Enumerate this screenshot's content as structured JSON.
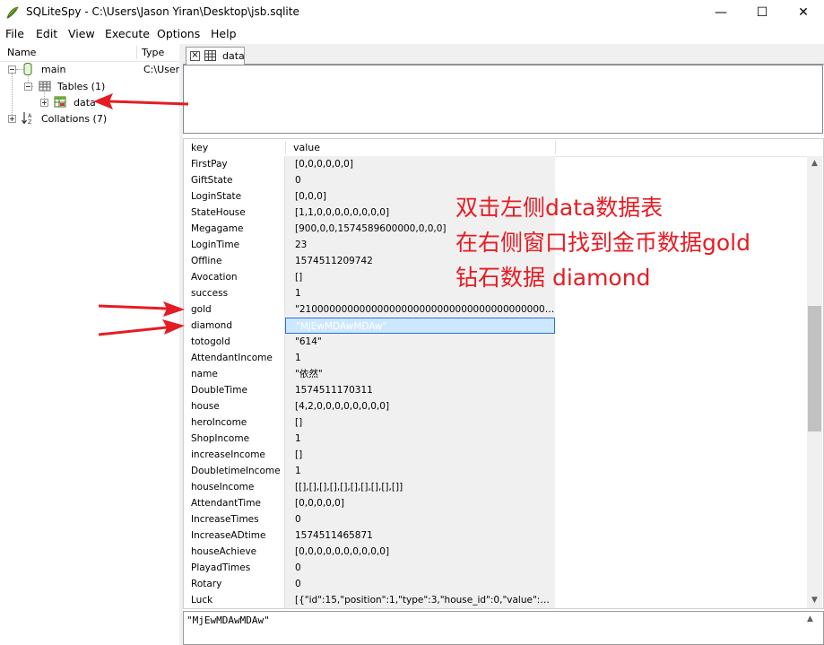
{
  "window": {
    "title": "SQLiteSpy - C:\\Users\\Jason Yiran\\Desktop\\jsb.sqlite",
    "minimize_glyph": "—",
    "maximize_glyph": "☐",
    "close_glyph": "✕"
  },
  "menu": {
    "items": [
      "File",
      "Edit",
      "View",
      "Execute",
      "Options",
      "Help"
    ]
  },
  "tree": {
    "columns": {
      "name": "Name",
      "type": "Type"
    },
    "nodes": {
      "main": {
        "label": "main",
        "type": "C:\\User"
      },
      "tables": {
        "label": "Tables (1)"
      },
      "data": {
        "label": "data"
      },
      "collations": {
        "label": "Collations (7)"
      }
    }
  },
  "tab": {
    "label": "data",
    "close_glyph": "×"
  },
  "grid": {
    "headers": {
      "key": "key",
      "value": "value"
    },
    "rows": [
      {
        "key": "FirstPay",
        "value": "[0,0,0,0,0,0]"
      },
      {
        "key": "GiftState",
        "value": "0"
      },
      {
        "key": "LoginState",
        "value": "[0,0,0]"
      },
      {
        "key": "StateHouse",
        "value": "[1,1,0,0,0,0,0,0,0,0]"
      },
      {
        "key": "Megagame",
        "value": "[900,0,0,1574589600000,0,0,0]"
      },
      {
        "key": "LoginTime",
        "value": "23"
      },
      {
        "key": "Offline",
        "value": "1574511209742"
      },
      {
        "key": "Avocation",
        "value": "[]"
      },
      {
        "key": "success",
        "value": "1"
      },
      {
        "key": "gold",
        "value": "\"2100000000000000000000000000000000000000000\""
      },
      {
        "key": "diamond",
        "value": "\"MjEwMDAwMDAw\""
      },
      {
        "key": "totogold",
        "value": "\"614\""
      },
      {
        "key": "AttendantIncome",
        "value": "1"
      },
      {
        "key": "name",
        "value": "\"依然\""
      },
      {
        "key": "DoubleTime",
        "value": "1574511170311"
      },
      {
        "key": "house",
        "value": "[4,2,0,0,0,0,0,0,0,0]"
      },
      {
        "key": "heroIncome",
        "value": "[]"
      },
      {
        "key": "ShopIncome",
        "value": "1"
      },
      {
        "key": "increaseIncome",
        "value": "[]"
      },
      {
        "key": "DoubletimeIncome",
        "value": "1"
      },
      {
        "key": "houseIncome",
        "value": "[[],[],[],[],[],[],[],[],[],[]]"
      },
      {
        "key": "AttendantTime",
        "value": "[0,0,0,0,0]"
      },
      {
        "key": "IncreaseTimes",
        "value": "0"
      },
      {
        "key": "IncreaseADtime",
        "value": "1574511465871"
      },
      {
        "key": "houseAchieve",
        "value": "[0,0,0,0,0,0,0,0,0,0]"
      },
      {
        "key": "PlayadTimes",
        "value": "0"
      },
      {
        "key": "Rotary",
        "value": "0"
      },
      {
        "key": "Luck",
        "value": "[{\"id\":15,\"position\":1,\"type\":3,\"house_id\":0,\"value\":450,..."
      }
    ],
    "selected_row_index": 10
  },
  "cell_editor": {
    "text": "\"MjEwMDAwMDAw\""
  },
  "scrollbar": {
    "up_glyph": "▲",
    "down_glyph": "▼"
  },
  "annotation": {
    "line1": "双击左侧data数据表",
    "line2": "在右侧窗口找到金币数据gold",
    "line3": "钻石数据 diamond"
  },
  "colors": {
    "annotation": "#e51c23",
    "selection_fill": "#cce8ff",
    "value_cell_bg": "#f0f0f0"
  }
}
